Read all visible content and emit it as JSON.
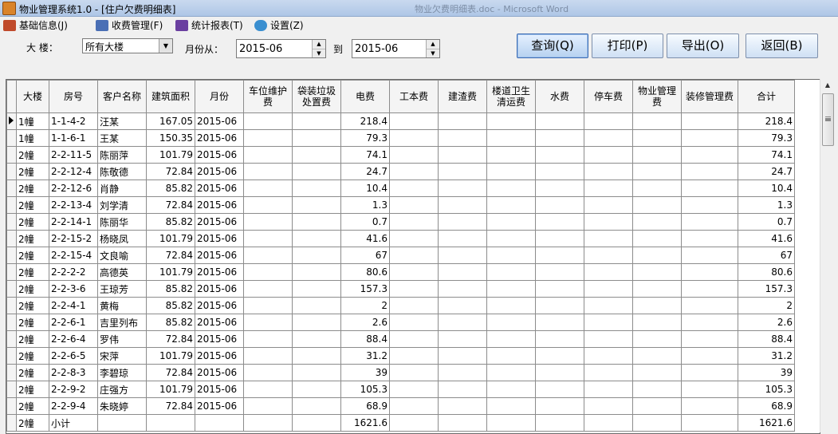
{
  "window": {
    "title": "物业管理系统1.0 - [住户欠费明细表]",
    "ghost_text": "物业欠费明细表.doc - Microsoft Word"
  },
  "menu": [
    {
      "label": "基础信息(J)",
      "icon": "base-info-icon",
      "color": "#c04a2b"
    },
    {
      "label": "收费管理(F)",
      "icon": "fee-mgmt-icon",
      "color": "#4a6fb5"
    },
    {
      "label": "统计报表(T)",
      "icon": "report-icon",
      "color": "#6a3fa0"
    },
    {
      "label": "设置(Z)",
      "icon": "settings-icon",
      "color": "#3a8fd0"
    }
  ],
  "filters": {
    "building_label": "大  楼：",
    "building_value": "所有大楼",
    "month_from_label": "月份从：",
    "month_from": "2015-06",
    "to_label": "到",
    "month_to": "2015-06"
  },
  "buttons": {
    "query": "查询(Q)",
    "print": "打印(P)",
    "export": "导出(O)",
    "back": "返回(B)"
  },
  "table": {
    "headers": [
      "大楼",
      "房号",
      "客户名称",
      "建筑面积",
      "月份",
      "车位维护费",
      "袋装垃圾处置费",
      "电费",
      "工本费",
      "建渣费",
      "楼道卫生清运费",
      "水费",
      "停车费",
      "物业管理费",
      "装修管理费",
      "合计"
    ],
    "rows": [
      [
        "1幢",
        "1-1-4-2",
        "汪某",
        "167.05",
        "2015-06",
        "",
        "",
        "218.4",
        "",
        "",
        "",
        "",
        "",
        "",
        "",
        "218.4"
      ],
      [
        "1幢",
        "1-1-6-1",
        "王某",
        "150.35",
        "2015-06",
        "",
        "",
        "79.3",
        "",
        "",
        "",
        "",
        "",
        "",
        "",
        "79.3"
      ],
      [
        "2幢",
        "2-2-11-5",
        "陈丽萍",
        "101.79",
        "2015-06",
        "",
        "",
        "74.1",
        "",
        "",
        "",
        "",
        "",
        "",
        "",
        "74.1"
      ],
      [
        "2幢",
        "2-2-12-4",
        "陈敬德",
        "72.84",
        "2015-06",
        "",
        "",
        "24.7",
        "",
        "",
        "",
        "",
        "",
        "",
        "",
        "24.7"
      ],
      [
        "2幢",
        "2-2-12-6",
        "肖静",
        "85.82",
        "2015-06",
        "",
        "",
        "10.4",
        "",
        "",
        "",
        "",
        "",
        "",
        "",
        "10.4"
      ],
      [
        "2幢",
        "2-2-13-4",
        "刘学清",
        "72.84",
        "2015-06",
        "",
        "",
        "1.3",
        "",
        "",
        "",
        "",
        "",
        "",
        "",
        "1.3"
      ],
      [
        "2幢",
        "2-2-14-1",
        "陈丽华",
        "85.82",
        "2015-06",
        "",
        "",
        "0.7",
        "",
        "",
        "",
        "",
        "",
        "",
        "",
        "0.7"
      ],
      [
        "2幢",
        "2-2-15-2",
        "杨晓凤",
        "101.79",
        "2015-06",
        "",
        "",
        "41.6",
        "",
        "",
        "",
        "",
        "",
        "",
        "",
        "41.6"
      ],
      [
        "2幢",
        "2-2-15-4",
        "文良喻",
        "72.84",
        "2015-06",
        "",
        "",
        "67",
        "",
        "",
        "",
        "",
        "",
        "",
        "",
        "67"
      ],
      [
        "2幢",
        "2-2-2-2",
        "高德英",
        "101.79",
        "2015-06",
        "",
        "",
        "80.6",
        "",
        "",
        "",
        "",
        "",
        "",
        "",
        "80.6"
      ],
      [
        "2幢",
        "2-2-3-6",
        "王琼芳",
        "85.82",
        "2015-06",
        "",
        "",
        "157.3",
        "",
        "",
        "",
        "",
        "",
        "",
        "",
        "157.3"
      ],
      [
        "2幢",
        "2-2-4-1",
        "黄梅",
        "85.82",
        "2015-06",
        "",
        "",
        "2",
        "",
        "",
        "",
        "",
        "",
        "",
        "",
        "2"
      ],
      [
        "2幢",
        "2-2-6-1",
        "吉里列布",
        "85.82",
        "2015-06",
        "",
        "",
        "2.6",
        "",
        "",
        "",
        "",
        "",
        "",
        "",
        "2.6"
      ],
      [
        "2幢",
        "2-2-6-4",
        "罗伟",
        "72.84",
        "2015-06",
        "",
        "",
        "88.4",
        "",
        "",
        "",
        "",
        "",
        "",
        "",
        "88.4"
      ],
      [
        "2幢",
        "2-2-6-5",
        "宋萍",
        "101.79",
        "2015-06",
        "",
        "",
        "31.2",
        "",
        "",
        "",
        "",
        "",
        "",
        "",
        "31.2"
      ],
      [
        "2幢",
        "2-2-8-3",
        "李碧琼",
        "72.84",
        "2015-06",
        "",
        "",
        "39",
        "",
        "",
        "",
        "",
        "",
        "",
        "",
        "39"
      ],
      [
        "2幢",
        "2-2-9-2",
        "庄强方",
        "101.79",
        "2015-06",
        "",
        "",
        "105.3",
        "",
        "",
        "",
        "",
        "",
        "",
        "",
        "105.3"
      ],
      [
        "2幢",
        "2-2-9-4",
        "朱晓婷",
        "72.84",
        "2015-06",
        "",
        "",
        "68.9",
        "",
        "",
        "",
        "",
        "",
        "",
        "",
        "68.9"
      ],
      [
        "2幢",
        "小计",
        "",
        "",
        "",
        "",
        "",
        "1621.6",
        "",
        "",
        "",
        "",
        "",
        "",
        "",
        "1621.6"
      ]
    ]
  }
}
